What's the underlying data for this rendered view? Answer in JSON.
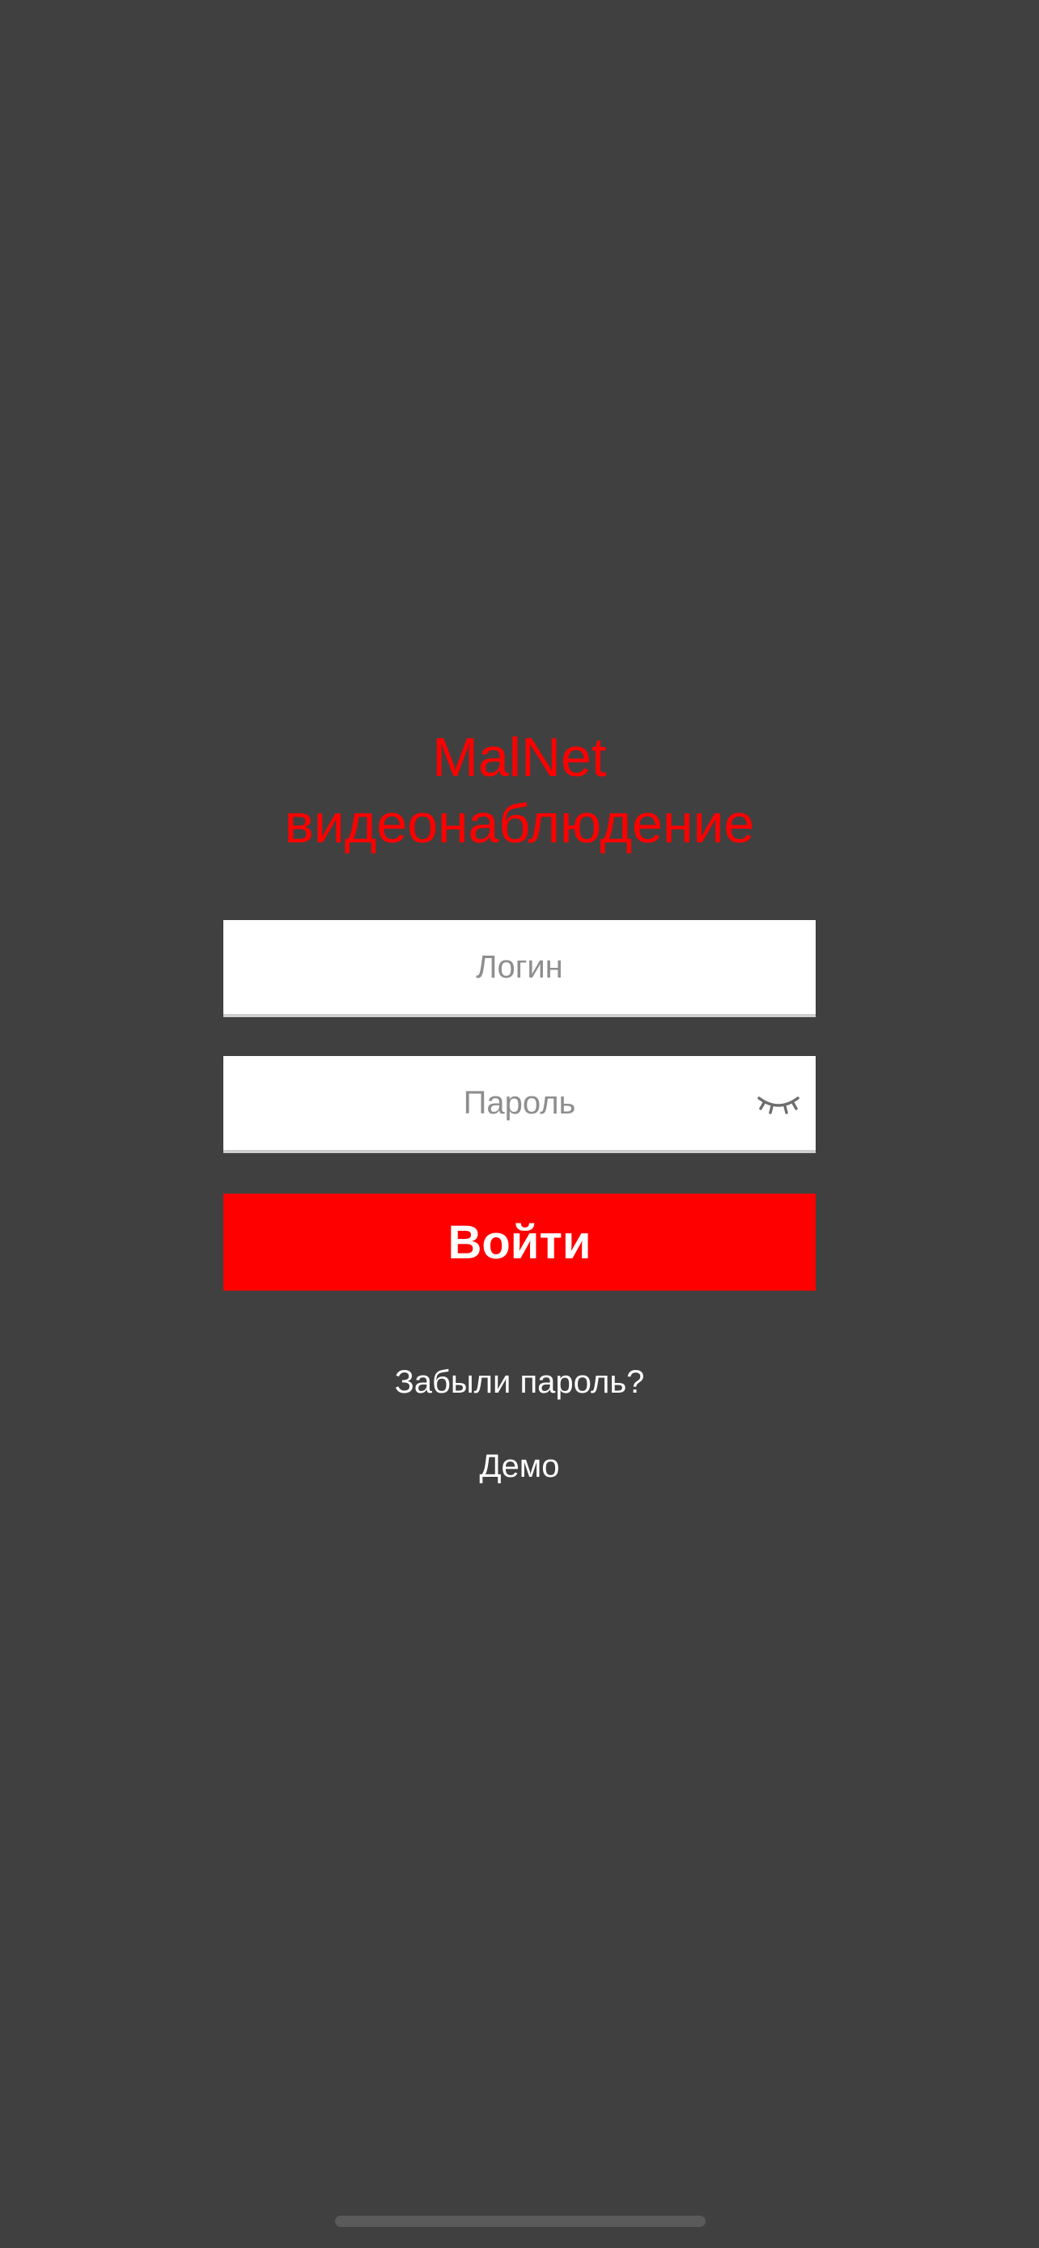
{
  "app": {
    "title_line1": "MalNet",
    "title_line2": "видеонаблюдение",
    "brand_color": "#ff0000",
    "background_color": "#404040"
  },
  "form": {
    "login_placeholder": "Логин",
    "login_value": "",
    "password_placeholder": "Пароль",
    "password_value": "",
    "password_toggle_icon": "eye-closed-icon",
    "submit_label": "Войти"
  },
  "links": {
    "forgot_password": "Забыли пароль?",
    "demo": "Демо"
  }
}
